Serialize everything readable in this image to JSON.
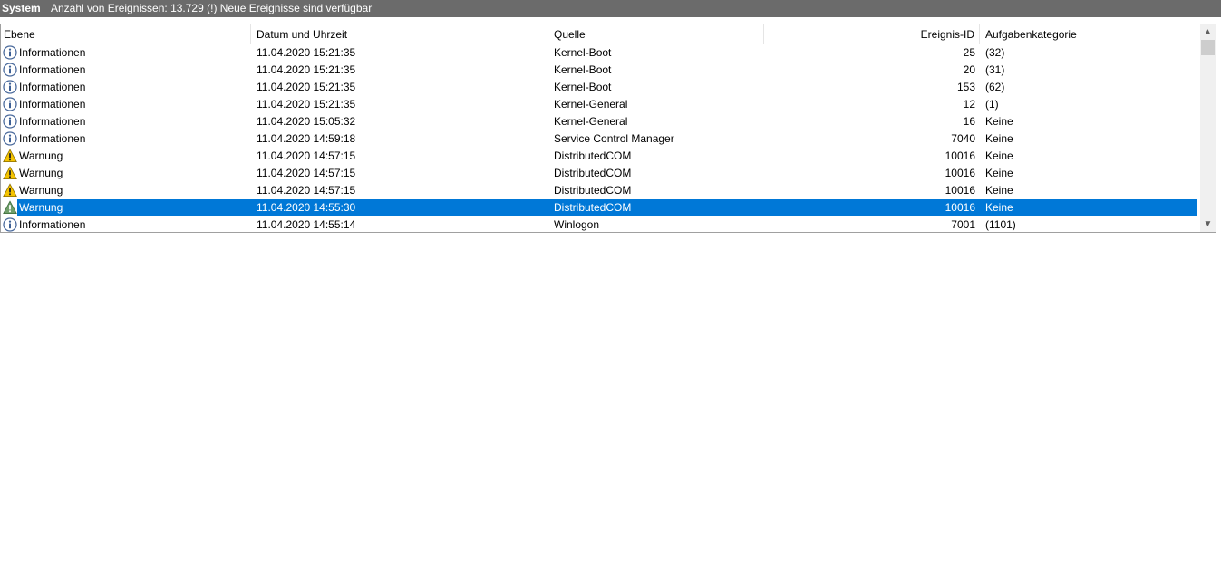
{
  "header": {
    "log_name": "System",
    "event_count_text": "Anzahl von Ereignissen: 13.729 (!) Neue Ereignisse sind verfügbar"
  },
  "table": {
    "columns": [
      "Ebene",
      "Datum und Uhrzeit",
      "Quelle",
      "Ereignis-ID",
      "Aufgabenkategorie"
    ],
    "rows": [
      {
        "level": "Informationen",
        "icon": "info-icon",
        "datetime": "11.04.2020 15:21:35",
        "source": "Kernel-Boot",
        "event_id": "25",
        "category": "(32)"
      },
      {
        "level": "Informationen",
        "icon": "info-icon",
        "datetime": "11.04.2020 15:21:35",
        "source": "Kernel-Boot",
        "event_id": "20",
        "category": "(31)"
      },
      {
        "level": "Informationen",
        "icon": "info-icon",
        "datetime": "11.04.2020 15:21:35",
        "source": "Kernel-Boot",
        "event_id": "153",
        "category": "(62)"
      },
      {
        "level": "Informationen",
        "icon": "info-icon",
        "datetime": "11.04.2020 15:21:35",
        "source": "Kernel-General",
        "event_id": "12",
        "category": "(1)"
      },
      {
        "level": "Informationen",
        "icon": "info-icon",
        "datetime": "11.04.2020 15:05:32",
        "source": "Kernel-General",
        "event_id": "16",
        "category": "Keine"
      },
      {
        "level": "Informationen",
        "icon": "info-icon",
        "datetime": "11.04.2020 14:59:18",
        "source": "Service Control Manager",
        "event_id": "7040",
        "category": "Keine"
      },
      {
        "level": "Warnung",
        "icon": "warning-icon",
        "datetime": "11.04.2020 14:57:15",
        "source": "DistributedCOM",
        "event_id": "10016",
        "category": "Keine"
      },
      {
        "level": "Warnung",
        "icon": "warning-icon",
        "datetime": "11.04.2020 14:57:15",
        "source": "DistributedCOM",
        "event_id": "10016",
        "category": "Keine"
      },
      {
        "level": "Warnung",
        "icon": "warning-icon",
        "datetime": "11.04.2020 14:57:15",
        "source": "DistributedCOM",
        "event_id": "10016",
        "category": "Keine"
      },
      {
        "level": "Warnung",
        "icon": "warning-icon",
        "datetime": "11.04.2020 14:55:30",
        "source": "DistributedCOM",
        "event_id": "10016",
        "category": "Keine",
        "selected": true
      },
      {
        "level": "Informationen",
        "icon": "info-icon",
        "datetime": "11.04.2020 14:55:14",
        "source": "Winlogon",
        "event_id": "7001",
        "category": "(1101)"
      }
    ]
  },
  "scrollbar": {
    "up_icon": "chevron-up-icon",
    "down_icon": "chevron-down-icon"
  },
  "colors": {
    "title_bar": "#6b6b6b",
    "selection": "#0078d7",
    "info_icon": "#4a6a9c",
    "warning_icon": "#f5c400"
  }
}
